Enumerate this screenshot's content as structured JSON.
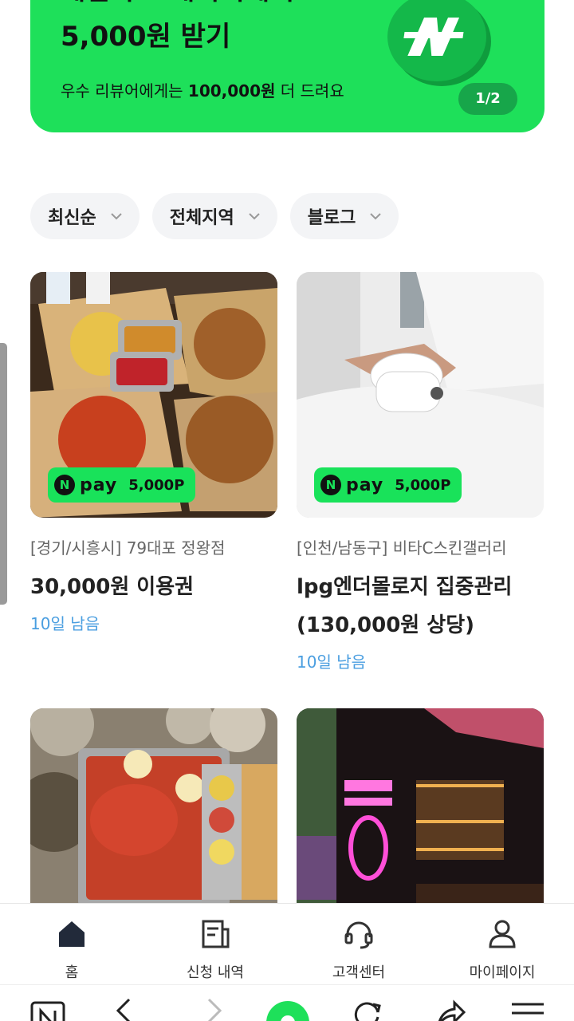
{
  "banner": {
    "title_line1": "체험하고 네이버페이",
    "title_line2": "5,000원 받기",
    "subtitle_pre": "우수 리뷰어에게는 ",
    "subtitle_bold": "100,000원",
    "subtitle_post": " 더 드려요",
    "pager": "1/2",
    "bg_color": "#1ee05a"
  },
  "filters": [
    {
      "label": "최신순"
    },
    {
      "label": "전체지역"
    },
    {
      "label": "블로그"
    }
  ],
  "cards": [
    {
      "store": "[경기/시흥시] 79대포 정왕점",
      "title": "30,000원 이용권",
      "remain": "10일 남음",
      "badge_logo": "N",
      "badge_pay": "pay",
      "badge_points": "5,000P"
    },
    {
      "store": "[인천/남동구] 비타C스킨갤러리",
      "title": "lpg엔더몰로지 집중관리 (130,000원 상당)",
      "remain": "10일 남음",
      "badge_logo": "N",
      "badge_pay": "pay",
      "badge_points": "5,000P"
    },
    {
      "store": "",
      "title": "",
      "remain": ""
    },
    {
      "store": "",
      "title": "",
      "remain": ""
    }
  ],
  "bottom_nav": [
    {
      "label": "홈",
      "icon": "home-icon"
    },
    {
      "label": "신청 내역",
      "icon": "list-icon"
    },
    {
      "label": "고객센터",
      "icon": "headset-icon"
    },
    {
      "label": "마이페이지",
      "icon": "person-icon"
    }
  ],
  "browser_bar": {
    "icons": [
      "naver-n-icon",
      "back-icon",
      "forward-icon",
      "home-green-icon",
      "refresh-icon",
      "share-icon",
      "menu-icon"
    ]
  }
}
